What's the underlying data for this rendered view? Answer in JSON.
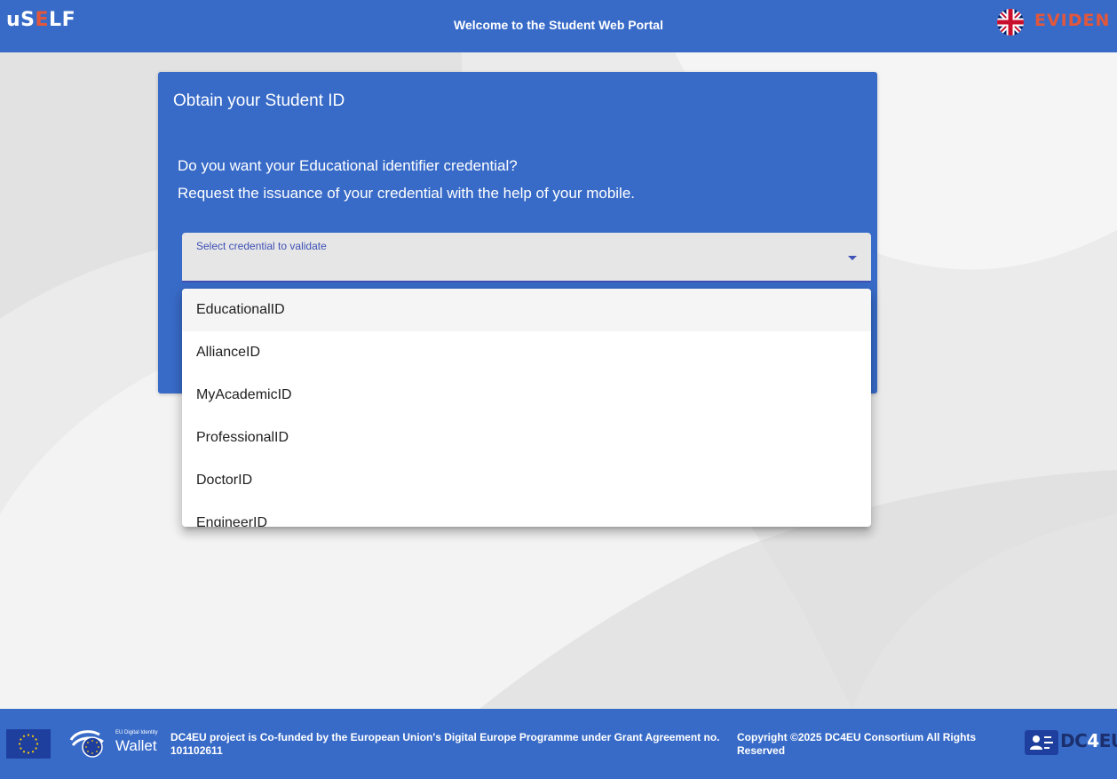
{
  "header": {
    "logo_prefix": "uS",
    "logo_e": "E",
    "logo_suffix": "LF",
    "title": "Welcome to the Student Web Portal",
    "partner_logo": "EVIDEN",
    "language_icon": "uk-flag-icon"
  },
  "card": {
    "title": "Obtain your Student ID",
    "line1": "Do you want your Educational identifier credential?",
    "line2": "Request the issuance of your credential with the help of your mobile."
  },
  "select": {
    "label": "Select credential to validate",
    "value": "",
    "arrow_icon": "caret-down-icon"
  },
  "dropdown": {
    "options": [
      "EducationalID",
      "AllianceID",
      "MyAcademicID",
      "ProfessionalID",
      "DoctorID",
      "EngineerID"
    ],
    "active_index": 0
  },
  "footer": {
    "wallet_small": "EU Digital Identity",
    "wallet_big": "Wallet",
    "funding_text": "DC4EU project is Co-funded by the European Union's Digital Europe Programme under Grant Agreement no. 101102611",
    "copyright": "Copyright ©2025 DC4EU Consortium All Rights Reserved",
    "dc4eu_prefix": "DC",
    "dc4eu_four": "4",
    "dc4eu_suffix": "EU"
  },
  "colors": {
    "primary_blue": "#386bc8",
    "accent_orange": "#e2573c",
    "select_indicator": "#3f51b5"
  }
}
